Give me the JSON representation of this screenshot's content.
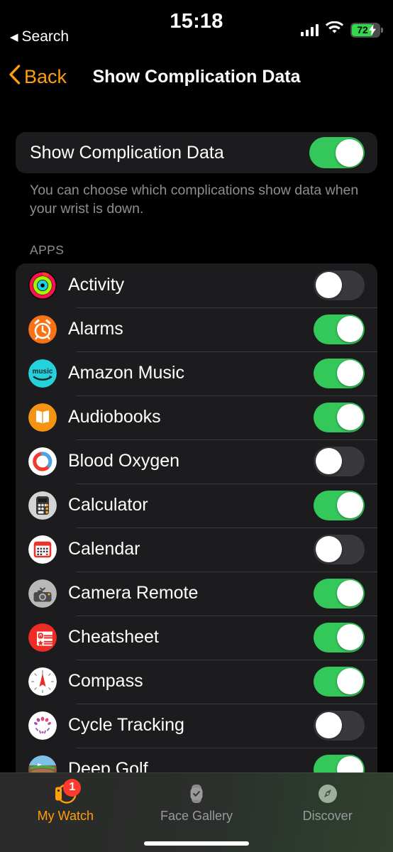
{
  "status_bar": {
    "time": "15:18",
    "back_to_app": "Search",
    "back_triangle": "◀",
    "battery_percent": "72",
    "battery_charging": true,
    "bolt": "⚡"
  },
  "nav_bar": {
    "back_label": "Back",
    "title": "Show Complication Data",
    "accent_color": "#FF9F0A"
  },
  "main_setting": {
    "label": "Show Complication Data",
    "enabled": true
  },
  "footnote": "You can choose which complications show data when your wrist is down.",
  "section_header": "APPS",
  "colors": {
    "toggle_on": "#34C759",
    "toggle_off": "#39393D",
    "card_bg": "#1C1C1E",
    "separator": "#3A3A3C",
    "secondary_text": "#8E8E93",
    "badge_red": "#FF3B30"
  },
  "apps": [
    {
      "label": "Activity",
      "icon": "activity-rings-icon",
      "enabled": false
    },
    {
      "label": "Alarms",
      "icon": "alarm-clock-icon",
      "enabled": true
    },
    {
      "label": "Amazon Music",
      "icon": "amazon-music-icon",
      "enabled": true
    },
    {
      "label": "Audiobooks",
      "icon": "audiobooks-icon",
      "enabled": true
    },
    {
      "label": "Blood Oxygen",
      "icon": "blood-oxygen-icon",
      "enabled": false
    },
    {
      "label": "Calculator",
      "icon": "calculator-icon",
      "enabled": true
    },
    {
      "label": "Calendar",
      "icon": "calendar-icon",
      "enabled": false
    },
    {
      "label": "Camera Remote",
      "icon": "camera-remote-icon",
      "enabled": true
    },
    {
      "label": "Cheatsheet",
      "icon": "cheatsheet-icon",
      "enabled": true
    },
    {
      "label": "Compass",
      "icon": "compass-icon",
      "enabled": true
    },
    {
      "label": "Cycle Tracking",
      "icon": "cycle-tracking-icon",
      "enabled": false
    },
    {
      "label": "Deep Golf",
      "icon": "deep-golf-icon",
      "enabled": true
    }
  ],
  "tab_bar": {
    "tabs": [
      {
        "label": "My Watch",
        "icon": "watch-icon",
        "active": true,
        "badge": "1"
      },
      {
        "label": "Face Gallery",
        "icon": "watch-check-icon",
        "active": false,
        "badge": ""
      },
      {
        "label": "Discover",
        "icon": "compass-tab-icon",
        "active": false,
        "badge": ""
      }
    ]
  }
}
